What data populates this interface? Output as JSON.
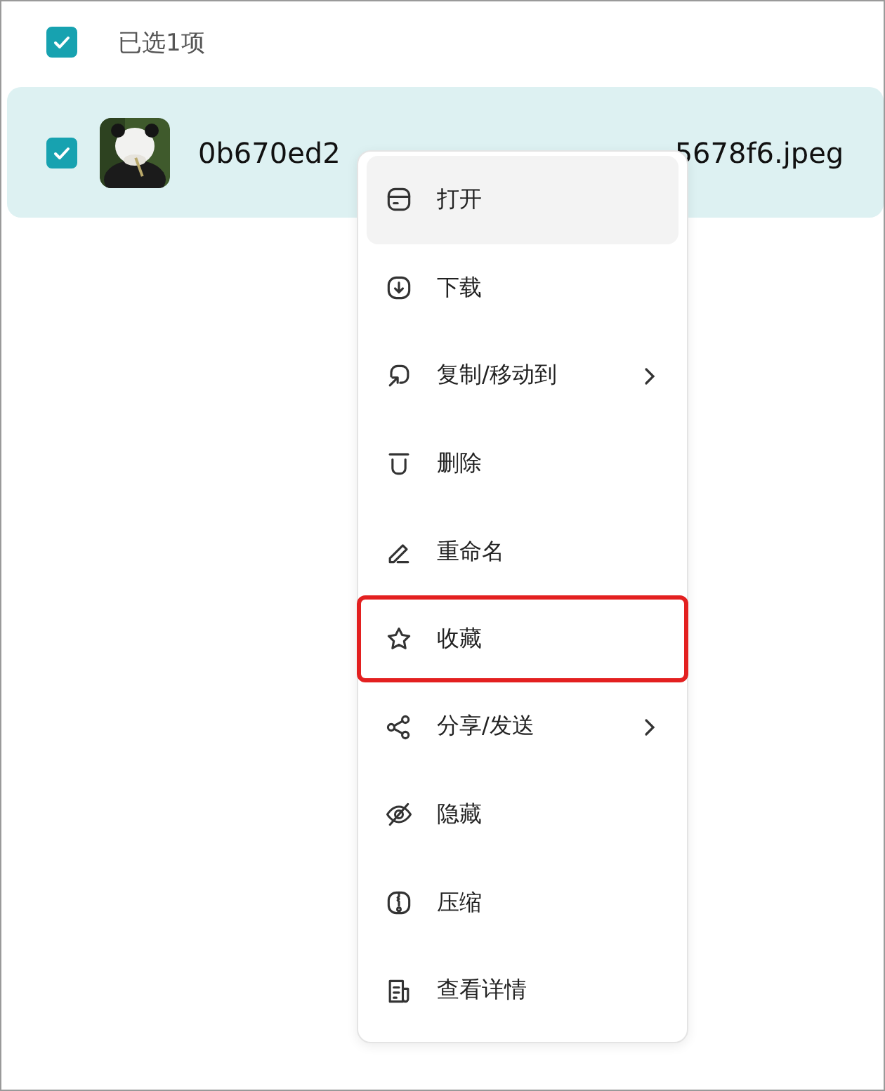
{
  "header": {
    "checked": true,
    "label": "已选1项"
  },
  "file": {
    "checked": true,
    "selected": true,
    "kind": "picture",
    "name_start": "0b670ed2",
    "name_end": "5678f6.jpeg"
  },
  "context_menu": {
    "items": [
      {
        "label": "打开",
        "hovered": true,
        "submenu": false,
        "marked": false
      },
      {
        "label": "下载",
        "hovered": false,
        "submenu": false,
        "marked": false
      },
      {
        "label": "复制/移动到",
        "hovered": false,
        "submenu": true,
        "marked": false
      },
      {
        "label": "删除",
        "hovered": false,
        "submenu": false,
        "marked": false
      },
      {
        "label": "重命名",
        "hovered": false,
        "submenu": false,
        "marked": false
      },
      {
        "label": "收藏",
        "hovered": false,
        "submenu": false,
        "marked": true
      },
      {
        "label": "分享/发送",
        "hovered": false,
        "submenu": true,
        "marked": false
      },
      {
        "label": "隐藏",
        "hovered": false,
        "submenu": false,
        "marked": false
      },
      {
        "label": "压缩",
        "hovered": false,
        "submenu": false,
        "marked": false
      },
      {
        "label": "查看详情",
        "hovered": false,
        "submenu": false,
        "marked": false
      }
    ]
  }
}
